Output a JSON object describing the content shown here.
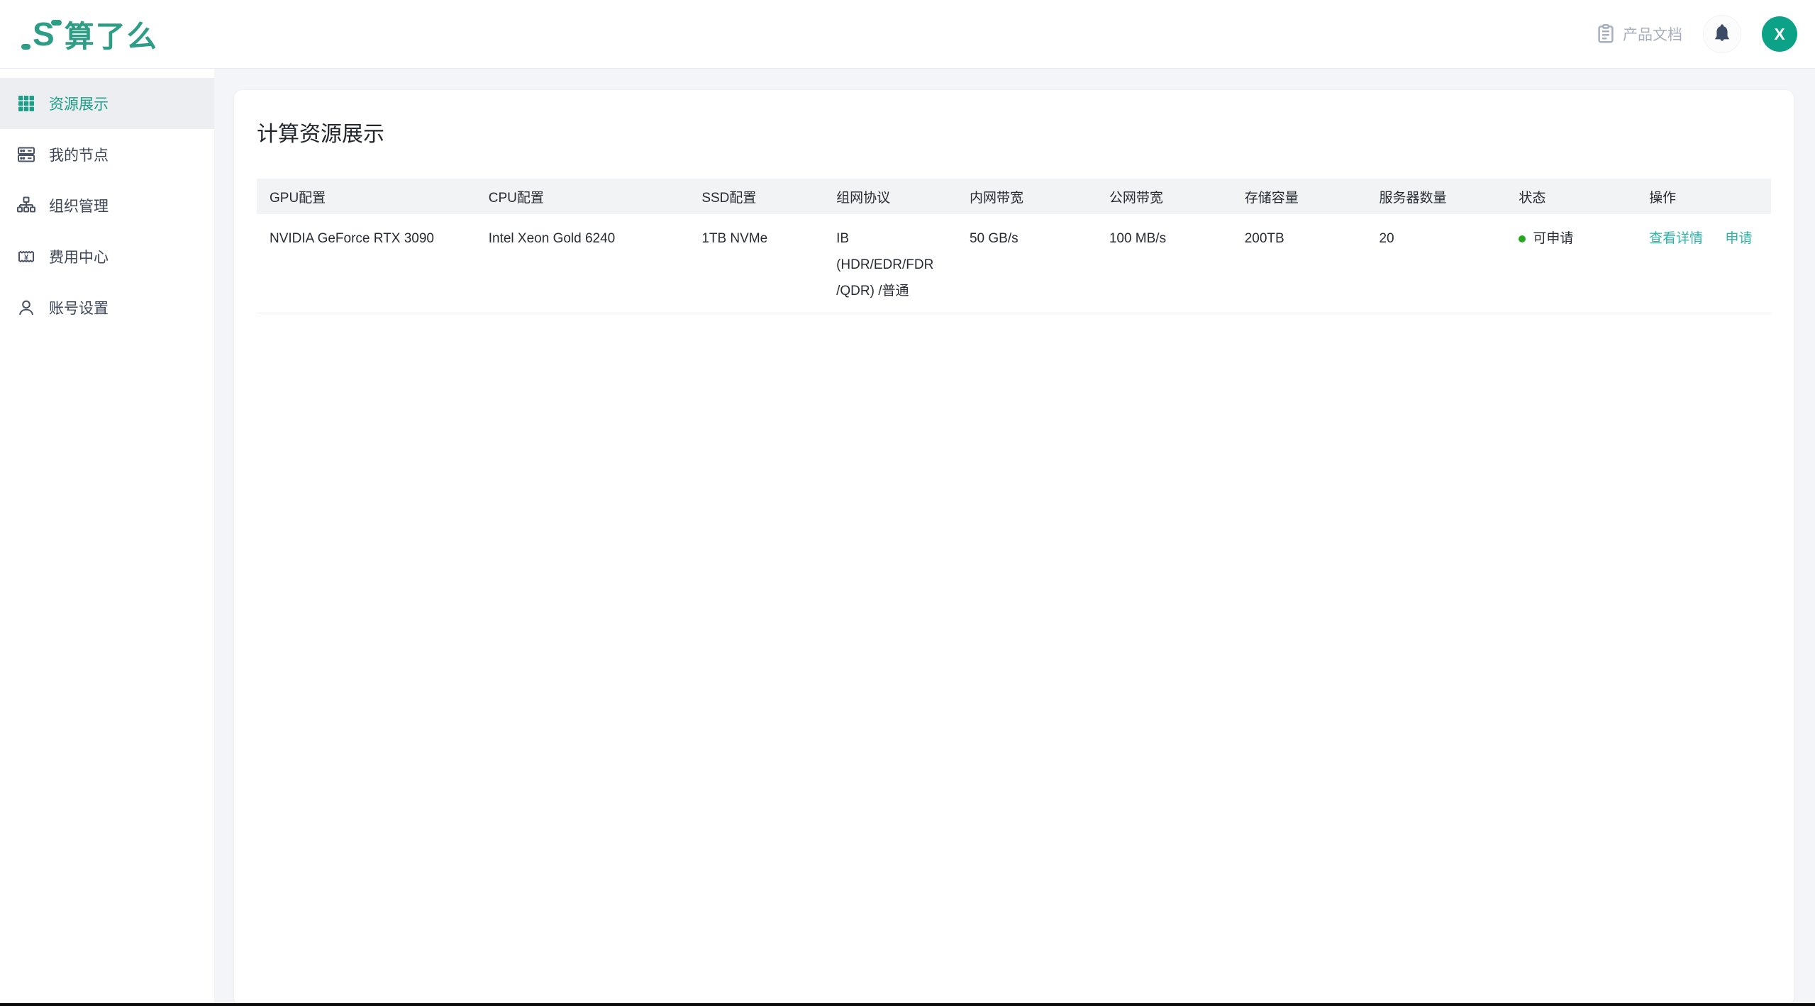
{
  "brand": {
    "logo_mark": "S",
    "name": "算了么"
  },
  "header": {
    "doc_link_label": "产品文档",
    "avatar_initial": "X"
  },
  "sidebar": {
    "items": [
      {
        "label": "资源展示",
        "icon": "grid-icon",
        "active": true
      },
      {
        "label": "我的节点",
        "icon": "server-icon",
        "active": false
      },
      {
        "label": "组织管理",
        "icon": "sitemap-icon",
        "active": false
      },
      {
        "label": "费用中心",
        "icon": "billing-icon",
        "active": false
      },
      {
        "label": "账号设置",
        "icon": "user-icon",
        "active": false
      }
    ]
  },
  "main": {
    "title": "计算资源展示",
    "table": {
      "columns": [
        "GPU配置",
        "CPU配置",
        "SSD配置",
        "组网协议",
        "内网带宽",
        "公网带宽",
        "存储容量",
        "服务器数量",
        "状态",
        "操作"
      ],
      "rows": [
        {
          "gpu": "NVIDIA GeForce RTX 3090",
          "cpu": "Intel Xeon Gold 6240",
          "ssd": "1TB NVMe",
          "network": "IB (HDR/EDR/FDR /QDR) /普通",
          "internal_bandwidth": "50 GB/s",
          "public_bandwidth": "100 MB/s",
          "storage": "200TB",
          "server_count": "20",
          "status": "可申请",
          "actions": [
            "查看详情",
            "申请"
          ]
        }
      ]
    }
  },
  "icons": {
    "top_right": [
      "clipboard-icon",
      "bell-icon"
    ],
    "status_dot": "green-dot"
  },
  "colors": {
    "brand_teal": "#2e9d85",
    "active_menu_teal": "#1d9e88",
    "link_teal": "#2fb3a4",
    "avatar_green": "#0ca287",
    "status_green": "#23a81e",
    "page_bg": "#f4f5f8",
    "active_item_bg": "#eceef2",
    "table_header_bg": "#f2f3f5",
    "muted_gray": "#a7afbe"
  }
}
